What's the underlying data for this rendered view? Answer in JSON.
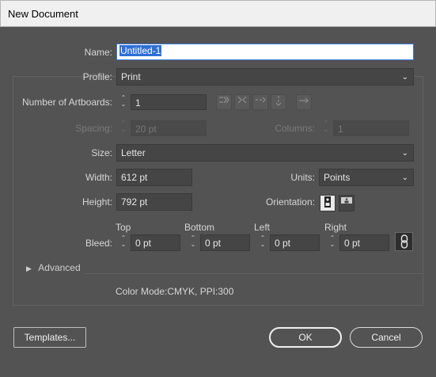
{
  "window": {
    "title": "New Document"
  },
  "name": {
    "label": "Name:",
    "value": "Untitled-1"
  },
  "profile": {
    "label": "Profile:",
    "value": "Print"
  },
  "artboards": {
    "label": "Number of Artboards:",
    "value": "1"
  },
  "spacing": {
    "label": "Spacing:",
    "value": "20 pt"
  },
  "columns": {
    "label": "Columns:",
    "value": "1"
  },
  "size": {
    "label": "Size:",
    "value": "Letter"
  },
  "width": {
    "label": "Width:",
    "value": "612 pt"
  },
  "units": {
    "label": "Units:",
    "value": "Points"
  },
  "height": {
    "label": "Height:",
    "value": "792 pt"
  },
  "orientation": {
    "label": "Orientation:",
    "selected": "portrait"
  },
  "bleed": {
    "label": "Bleed:",
    "top": {
      "label": "Top",
      "value": "0 pt"
    },
    "bottom": {
      "label": "Bottom",
      "value": "0 pt"
    },
    "left": {
      "label": "Left",
      "value": "0 pt"
    },
    "right": {
      "label": "Right",
      "value": "0 pt"
    }
  },
  "advanced": {
    "label": "Advanced",
    "expanded": false
  },
  "info": {
    "text": "Color Mode:CMYK, PPI:300"
  },
  "buttons": {
    "templates": "Templates...",
    "ok": "OK",
    "cancel": "Cancel"
  },
  "icons": {
    "arrange_grid_by_row": "grid-by-row-icon",
    "arrange_grid_by_column": "grid-by-column-icon",
    "arrange_by_row": "arrange-by-row-icon",
    "arrange_by_column": "arrange-by-column-icon",
    "layout_direction": "right-arrow-icon",
    "link_bleed": "link-icon"
  },
  "colors": {
    "dialog_bg": "#535353",
    "field_bg": "#454545",
    "titlebar_bg": "#f0f0f0",
    "selection": "#2f6fd6"
  }
}
